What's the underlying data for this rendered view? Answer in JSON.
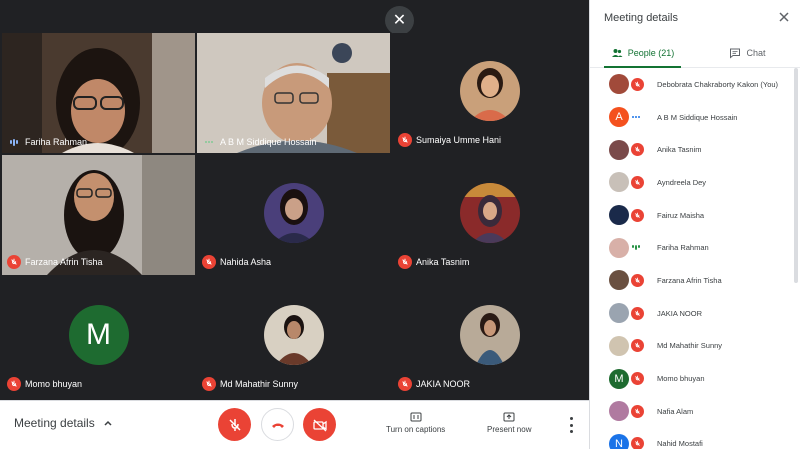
{
  "stage": {
    "tiles": [
      {
        "name": "Fariha Rahman",
        "status": "speaking"
      },
      {
        "name": "A B M Siddique Hossain",
        "status": "dots"
      },
      {
        "name": "Sumaiya Umme Hani",
        "status": "muted"
      },
      {
        "name": "Farzana Afrin Tisha",
        "status": "muted"
      },
      {
        "name": "Nahida Asha",
        "status": "muted"
      },
      {
        "name": "Anika Tasnim",
        "status": "muted"
      },
      {
        "name": "Momo bhuyan",
        "status": "muted",
        "initial": "M"
      },
      {
        "name": "Md Mahathir Sunny",
        "status": "muted"
      },
      {
        "name": "JAKIA NOOR",
        "status": "muted"
      }
    ]
  },
  "bottom_bar": {
    "meeting_details_label": "Meeting details",
    "captions_label": "Turn on captions",
    "present_label": "Present now"
  },
  "panel": {
    "title": "Meeting details",
    "tabs": [
      {
        "label": "People (21)",
        "icon": "people-icon"
      },
      {
        "label": "Chat",
        "icon": "chat-icon"
      }
    ],
    "people": [
      {
        "name": "Debobrata Chakraborty Kakon (You)",
        "status": "muted"
      },
      {
        "name": "A B M Siddique Hossain",
        "status": "dots",
        "initial": "A"
      },
      {
        "name": "Anika Tasnim",
        "status": "muted"
      },
      {
        "name": "Ayndreela Dey",
        "status": "muted"
      },
      {
        "name": "Fairuz Maisha",
        "status": "muted"
      },
      {
        "name": "Fariha Rahman",
        "status": "speaking"
      },
      {
        "name": "Farzana Afrin Tisha",
        "status": "muted"
      },
      {
        "name": "JAKIA NOOR",
        "status": "muted"
      },
      {
        "name": "Md Mahathir Sunny",
        "status": "muted"
      },
      {
        "name": "Momo bhuyan",
        "status": "muted",
        "initial": "M"
      },
      {
        "name": "Nafia Alam",
        "status": "muted"
      },
      {
        "name": "Nahid Mostafi",
        "status": "muted",
        "initial": "N"
      }
    ]
  },
  "colors": {
    "accent_green": "#137333",
    "mute_red": "#ea4335",
    "stage_bg": "#202124"
  }
}
